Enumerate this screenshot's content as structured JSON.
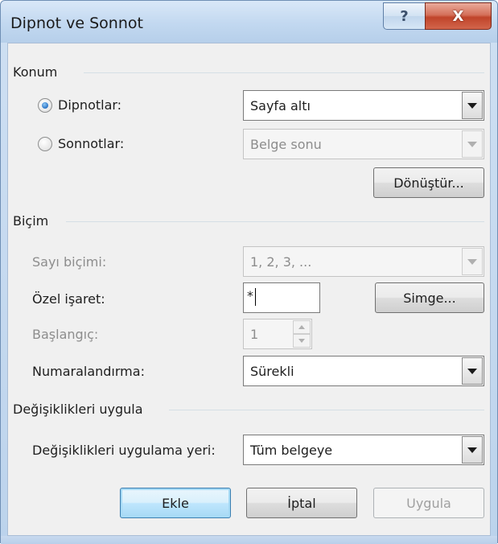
{
  "window": {
    "title": "Dipnot ve Sonnot"
  },
  "titlebar": {
    "help_icon": "question-mark-icon",
    "help_glyph": "?",
    "close_icon": "close-icon",
    "close_glyph": "X"
  },
  "konum": {
    "heading": "Konum",
    "dipnotlar_label": "Dipnotlar:",
    "dipnotlar_selected": true,
    "dipnotlar_value": "Sayfa altı",
    "sonnotlar_label": "Sonnotlar:",
    "sonnotlar_selected": false,
    "sonnotlar_value": "Belge sonu",
    "convert_button": "Dönüştür..."
  },
  "bicim": {
    "heading": "Biçim",
    "number_format_label": "Sayı biçimi:",
    "number_format_value": "1, 2, 3, ...",
    "custom_mark_label": "Özel işaret:",
    "custom_mark_value": "*",
    "symbol_button": "Simge...",
    "start_at_label": "Başlangıç:",
    "start_at_value": "1",
    "numbering_label": "Numaralandırma:",
    "numbering_value": "Sürekli"
  },
  "apply": {
    "heading": "Değişiklikleri uygula",
    "apply_to_label": "Değişiklikleri uygulama yeri:",
    "apply_to_value": "Tüm belgeye"
  },
  "buttons": {
    "insert": "Ekle",
    "cancel": "İptal",
    "apply": "Uygula"
  },
  "colors": {
    "titlebar": "#c2d8f0",
    "close_button": "#c0442a",
    "dialog_bg": "#f0f0f0",
    "default_button": "#bee6fd"
  }
}
